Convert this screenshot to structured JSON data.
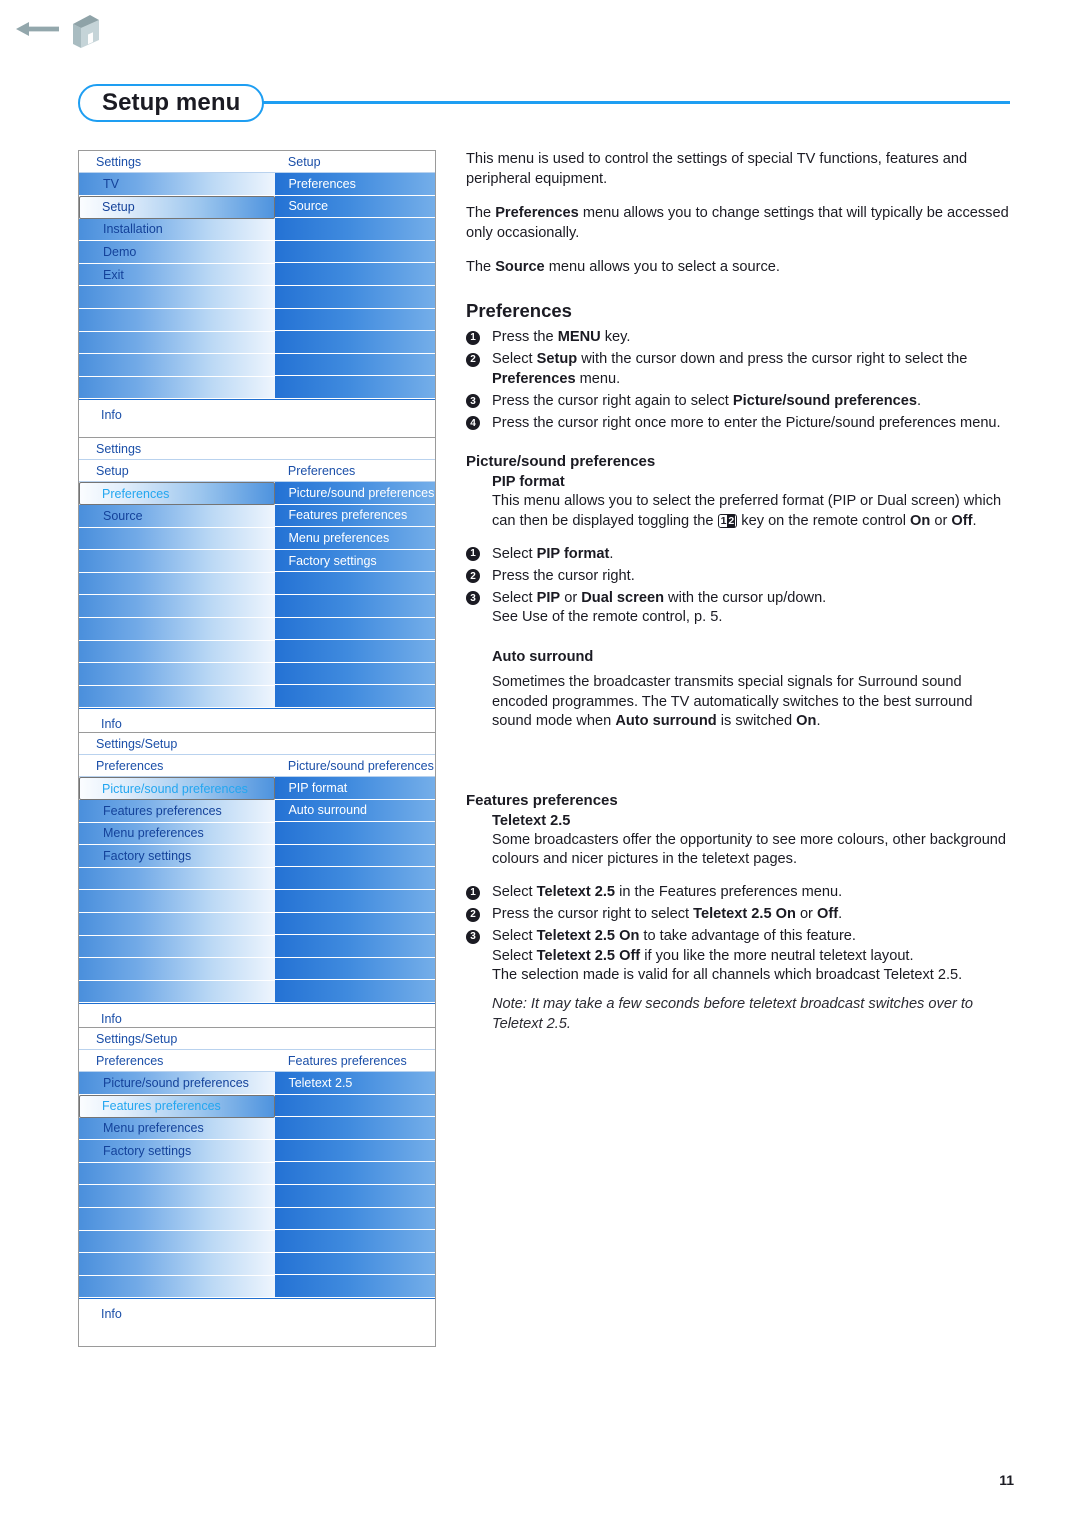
{
  "header": {
    "back_icon": "back-arrow-icon",
    "home_icon": "home-icon"
  },
  "page_title": "Setup menu",
  "page_number": "11",
  "osd_panels": [
    {
      "id": "panel-setup",
      "headers": [
        {
          "left": "Settings",
          "right": "Setup"
        }
      ],
      "left_rows": [
        {
          "label": "TV",
          "selected": false
        },
        {
          "label": "Setup",
          "selected": true,
          "dark_text": true
        },
        {
          "label": "Installation",
          "selected": false
        },
        {
          "label": "Demo",
          "selected": false
        },
        {
          "label": "Exit",
          "selected": false
        },
        {
          "label": "",
          "selected": false
        },
        {
          "label": "",
          "selected": false
        },
        {
          "label": "",
          "selected": false
        },
        {
          "label": "",
          "selected": false
        },
        {
          "label": "",
          "selected": false
        }
      ],
      "right_rows": [
        {
          "label": "Preferences"
        },
        {
          "label": "Source"
        },
        {
          "label": ""
        },
        {
          "label": ""
        },
        {
          "label": ""
        },
        {
          "label": ""
        },
        {
          "label": ""
        },
        {
          "label": ""
        },
        {
          "label": ""
        },
        {
          "label": ""
        }
      ],
      "footer": "Info"
    },
    {
      "id": "panel-preferences",
      "headers": [
        {
          "left": "Settings",
          "right": ""
        },
        {
          "left": "Setup",
          "right": "Preferences"
        }
      ],
      "left_rows": [
        {
          "label": "Preferences",
          "selected": true
        },
        {
          "label": "Source",
          "selected": false
        },
        {
          "label": "",
          "selected": false
        },
        {
          "label": "",
          "selected": false
        },
        {
          "label": "",
          "selected": false
        },
        {
          "label": "",
          "selected": false
        },
        {
          "label": "",
          "selected": false
        },
        {
          "label": "",
          "selected": false
        },
        {
          "label": "",
          "selected": false
        },
        {
          "label": "",
          "selected": false
        }
      ],
      "right_rows": [
        {
          "label": "Picture/sound preferences"
        },
        {
          "label": "Features preferences"
        },
        {
          "label": "Menu preferences"
        },
        {
          "label": "Factory settings"
        },
        {
          "label": ""
        },
        {
          "label": ""
        },
        {
          "label": ""
        },
        {
          "label": ""
        },
        {
          "label": ""
        },
        {
          "label": ""
        }
      ],
      "footer": "Info"
    },
    {
      "id": "panel-picture-sound",
      "headers": [
        {
          "left": "Settings/Setup",
          "right": ""
        },
        {
          "left": "Preferences",
          "right": "Picture/sound preferences"
        }
      ],
      "left_rows": [
        {
          "label": "Picture/sound preferences",
          "selected": true
        },
        {
          "label": "Features preferences",
          "selected": false
        },
        {
          "label": "Menu preferences",
          "selected": false
        },
        {
          "label": "Factory settings",
          "selected": false
        },
        {
          "label": "",
          "selected": false
        },
        {
          "label": "",
          "selected": false
        },
        {
          "label": "",
          "selected": false
        },
        {
          "label": "",
          "selected": false
        },
        {
          "label": "",
          "selected": false
        },
        {
          "label": "",
          "selected": false
        }
      ],
      "right_rows": [
        {
          "label": "PIP format"
        },
        {
          "label": "Auto surround"
        },
        {
          "label": ""
        },
        {
          "label": ""
        },
        {
          "label": ""
        },
        {
          "label": ""
        },
        {
          "label": ""
        },
        {
          "label": ""
        },
        {
          "label": ""
        },
        {
          "label": ""
        }
      ],
      "footer": "Info"
    },
    {
      "id": "panel-features",
      "headers": [
        {
          "left": "Settings/Setup",
          "right": ""
        },
        {
          "left": "Preferences",
          "right": "Features preferences"
        }
      ],
      "left_rows": [
        {
          "label": "Picture/sound preferences",
          "selected": false
        },
        {
          "label": "Features preferences",
          "selected": true
        },
        {
          "label": "Menu preferences",
          "selected": false
        },
        {
          "label": "Factory settings",
          "selected": false
        },
        {
          "label": "",
          "selected": false
        },
        {
          "label": "",
          "selected": false
        },
        {
          "label": "",
          "selected": false
        },
        {
          "label": "",
          "selected": false
        },
        {
          "label": "",
          "selected": false
        },
        {
          "label": "",
          "selected": false
        }
      ],
      "right_rows": [
        {
          "label": "Teletext 2.5"
        },
        {
          "label": ""
        },
        {
          "label": ""
        },
        {
          "label": ""
        },
        {
          "label": ""
        },
        {
          "label": ""
        },
        {
          "label": ""
        },
        {
          "label": ""
        },
        {
          "label": ""
        },
        {
          "label": ""
        }
      ],
      "footer": "Info"
    }
  ],
  "content": {
    "intro_1": "This menu is used to control the settings of special TV functions, features and peripheral equipment.",
    "intro_2_pre": "The ",
    "intro_2_b": "Preferences",
    "intro_2_post": " menu allows you to change settings that will typically be accessed only occasionally.",
    "intro_3_pre": "The ",
    "intro_3_b": "Source",
    "intro_3_post": " menu allows you to select a source.",
    "preferences_heading": "Preferences",
    "pref_step1_a": "Press the ",
    "pref_step1_b": "MENU",
    "pref_step1_c": " key.",
    "pref_step2_a": "Select ",
    "pref_step2_b": "Setup",
    "pref_step2_c": " with the cursor down and press the cursor right to select the ",
    "pref_step2_d": "Preferences",
    "pref_step2_e": " menu.",
    "pref_step3_a": "Press the cursor right again to select ",
    "pref_step3_b": "Picture/sound preferences",
    "pref_step3_c": ".",
    "pref_step4": "Press the cursor right once more to enter the Picture/sound preferences menu.",
    "ps_heading": "Picture/sound preferences",
    "pip_heading": "PIP format",
    "pip_body_a": "This menu allows you to select the preferred format (PIP or Dual screen) which can then be displayed toggling the ",
    "pip_key_1": "1",
    "pip_key_2": "2",
    "pip_body_b": " key on the remote control ",
    "pip_body_on": "On",
    "pip_body_or": " or ",
    "pip_body_off": "Off",
    "pip_body_c": ".",
    "pip_step1_a": "Select ",
    "pip_step1_b": "PIP format",
    "pip_step1_c": ".",
    "pip_step2": "Press the cursor right.",
    "pip_step3_a": "Select ",
    "pip_step3_b": "PIP",
    "pip_step3_c": " or ",
    "pip_step3_d": "Dual screen",
    "pip_step3_e": " with the cursor up/down.",
    "pip_step3_f": "See Use of the remote control, p. 5.",
    "auto_heading": "Auto surround",
    "auto_body_a": "Sometimes the broadcaster transmits special signals for Surround sound encoded programmes. The TV automatically switches to the best surround sound mode when ",
    "auto_body_b": "Auto surround",
    "auto_body_c": " is switched ",
    "auto_body_d": "On",
    "auto_body_e": ".",
    "features_heading": "Features preferences",
    "tt_heading": "Teletext 2.5",
    "tt_body": "Some broadcasters offer the opportunity to see more colours, other background colours and nicer pictures in the teletext pages.",
    "tt_step1_a": "Select ",
    "tt_step1_b": "Teletext 2.5",
    "tt_step1_c": " in the Features preferences menu.",
    "tt_step2_a": "Press the cursor right to select ",
    "tt_step2_b": "Teletext 2.5 On",
    "tt_step2_c": " or ",
    "tt_step2_d": "Off",
    "tt_step2_e": ".",
    "tt_step3_a": "Select ",
    "tt_step3_b": "Teletext 2.5 On",
    "tt_step3_c": " to take advantage of this feature.",
    "tt_step3_d": "Select ",
    "tt_step3_e": "Teletext 2.5 Off",
    "tt_step3_f": " if you like the more neutral teletext layout.",
    "tt_step3_g": "The selection made is valid for all channels which broadcast Teletext 2.5.",
    "tt_note": "Note: It may take a few seconds before teletext broadcast switches over to Teletext 2.5."
  },
  "colors": {
    "accent_blue": "#1e9ef2",
    "osd_label_blue": "#14429a",
    "osd_selected_cyan": "#23a6f0",
    "icon_gray": "#8fa3a8"
  }
}
